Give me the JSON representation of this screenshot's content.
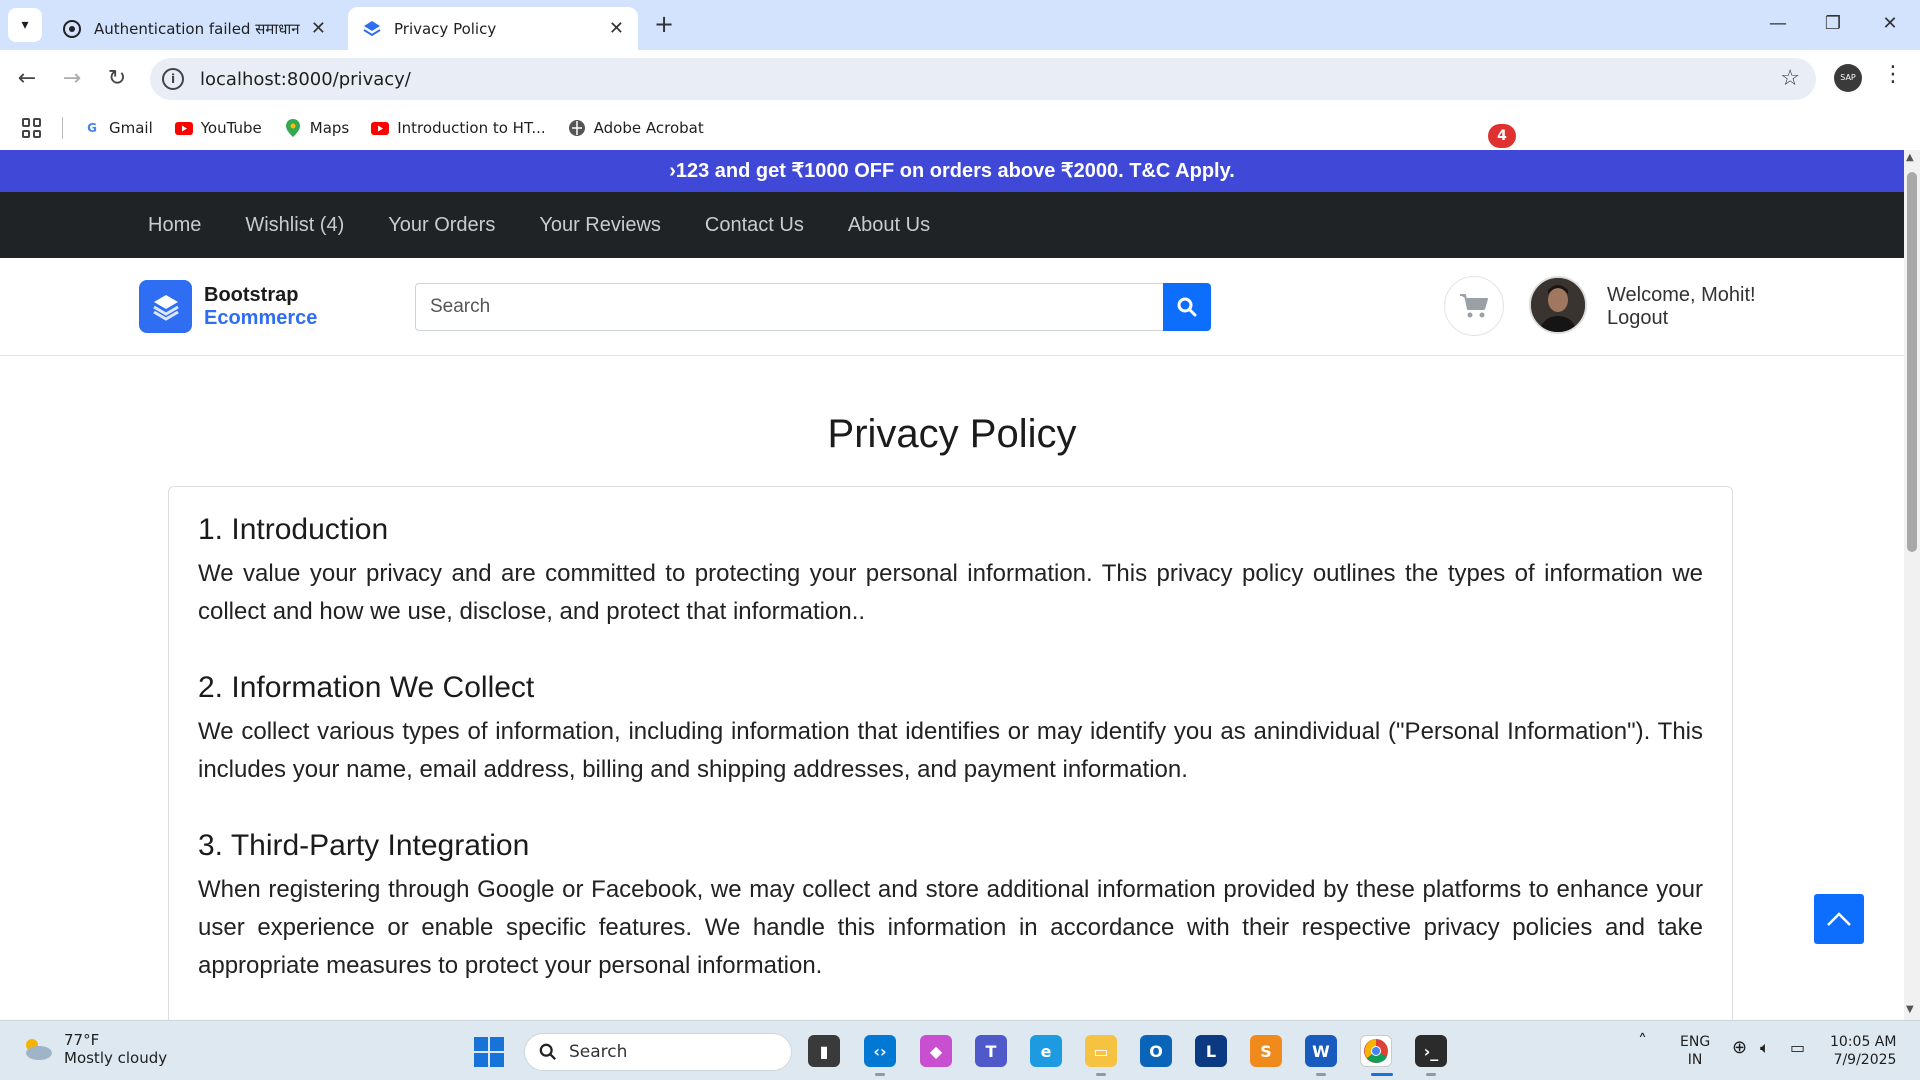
{
  "browser": {
    "tabs": [
      {
        "title": "Authentication failed समाधान",
        "active": false
      },
      {
        "title": "Privacy Policy",
        "active": true
      }
    ],
    "url": "localhost:8000/privacy/",
    "profile_label": "SAP",
    "bookmarks": [
      {
        "label": "Gmail",
        "icon": "google-icon"
      },
      {
        "label": "YouTube",
        "icon": "youtube-icon"
      },
      {
        "label": "Maps",
        "icon": "maps-pin-icon"
      },
      {
        "label": "Introduction to HT...",
        "icon": "youtube-icon"
      },
      {
        "label": "Adobe Acrobat",
        "icon": "acrobat-globe-icon"
      }
    ]
  },
  "site": {
    "promo": "›123 and get ₹1000 OFF on orders above ₹2000. T&C Apply.",
    "nav": [
      "Home",
      "Wishlist (4)",
      "Your Orders",
      "Your Reviews",
      "Contact Us",
      "About Us"
    ],
    "logo_line1": "Bootstrap",
    "logo_line2": "Ecommerce",
    "search_placeholder": "Search",
    "cart_count": "4",
    "welcome": "Welcome, Mohit!",
    "logout": "Logout",
    "accent_color": "#0d6efd",
    "promo_color": "#4048d8"
  },
  "page": {
    "title": "Privacy Policy",
    "sections": [
      {
        "heading": "1. Introduction",
        "body": "We value your privacy and are committed to protecting your personal information. This privacy policy outlines the types of information we collect and how we use, disclose, and protect that information.."
      },
      {
        "heading": "2. Information We Collect",
        "body": "We collect various types of information, including information that identifies or may identify you as anindividual (\"Personal Information\"). This includes your name, email address, billing and shipping addresses, and payment information."
      },
      {
        "heading": "3. Third-Party Integration",
        "body": "When registering through Google or Facebook, we may collect and store additional information provided by these platforms to enhance your user experience or enable specific features. We handle this information in accordance with their respective privacy policies and take appropriate measures to protect your personal information."
      }
    ]
  },
  "taskbar": {
    "weather_temp": "77°F",
    "weather_desc": "Mostly cloudy",
    "search_label": "Search",
    "lang_line1": "ENG",
    "lang_line2": "IN",
    "time": "10:05 AM",
    "date": "7/9/2025"
  }
}
